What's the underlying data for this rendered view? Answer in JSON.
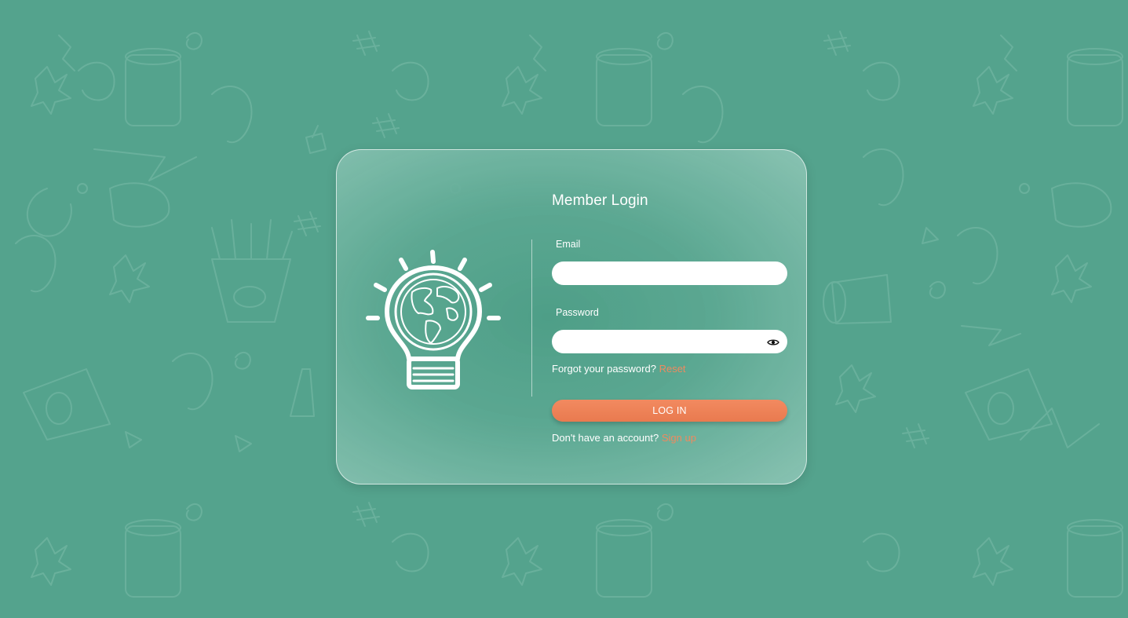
{
  "title": "Member Login",
  "email": {
    "label": "Email",
    "value": "",
    "placeholder": ""
  },
  "password": {
    "label": "Password",
    "value": "",
    "placeholder": ""
  },
  "forgot": {
    "text": "Forgot your password?",
    "link": "Reset"
  },
  "login_button": "LOG IN",
  "signup": {
    "text": "Don't have an account?",
    "link": "Sign up"
  },
  "icons": {
    "logo": "lightbulb-globe-icon",
    "password_toggle": "eye-icon"
  },
  "colors": {
    "background": "#54a38d",
    "accent": "#ee8a5f",
    "text": "#ffffff"
  }
}
